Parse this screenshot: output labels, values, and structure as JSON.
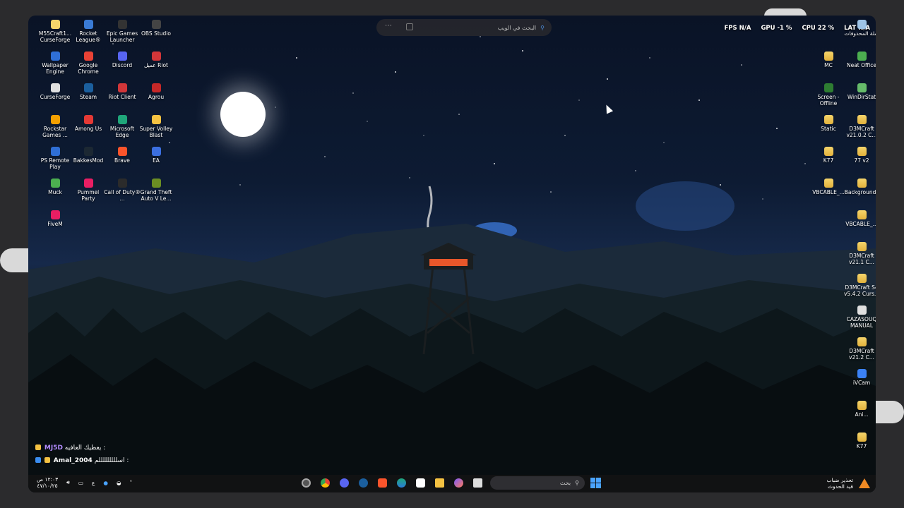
{
  "web_search": {
    "placeholder": "البحث في الويب"
  },
  "stats": {
    "fps_label": "FPS",
    "fps": "N/A",
    "gpu_label": "GPU",
    "gpu": "-1 %",
    "cpu_label": "CPU",
    "cpu": "22 %",
    "lat_label": "LAT",
    "lat": "N/A"
  },
  "desktop_left": [
    {
      "label": "M55Craft1... CurseForge",
      "icon": "curseforge-folder-icon",
      "color": "#f5d46b"
    },
    {
      "label": "Rocket League®",
      "icon": "rocket-league-icon",
      "color": "#3a7bd5"
    },
    {
      "label": "Epic Games Launcher",
      "icon": "epic-games-icon",
      "color": "#333333"
    },
    {
      "label": "OBS Studio",
      "icon": "obs-icon",
      "color": "#444444"
    },
    {
      "label": "Wallpaper Engine",
      "icon": "wallpaper-engine-icon",
      "color": "#2f6fd6"
    },
    {
      "label": "Google Chrome",
      "icon": "chrome-icon",
      "color": "#e94235"
    },
    {
      "label": "Discord",
      "icon": "discord-icon",
      "color": "#5865f2"
    },
    {
      "label": "عميل Riot",
      "icon": "riot-icon",
      "color": "#d13639"
    },
    {
      "label": "CurseForge",
      "icon": "curseforge-icon",
      "color": "#e0e0e0"
    },
    {
      "label": "Steam",
      "icon": "steam-icon",
      "color": "#1b5f9e"
    },
    {
      "label": "Riot Client",
      "icon": "riot-client-icon",
      "color": "#d13639"
    },
    {
      "label": "Agrou",
      "icon": "agrou-icon",
      "color": "#c62828"
    },
    {
      "label": "Rockstar Games ...",
      "icon": "rockstar-icon",
      "color": "#f4a000"
    },
    {
      "label": "Among Us",
      "icon": "among-us-icon",
      "color": "#e53935"
    },
    {
      "label": "Microsoft Edge",
      "icon": "edge-icon",
      "color": "#1fa67a"
    },
    {
      "label": "Super Volley Blast",
      "icon": "volley-icon",
      "color": "#f5c242"
    },
    {
      "label": "PS Remote Play",
      "icon": "ps-remote-icon",
      "color": "#2f6fd6"
    },
    {
      "label": "BakkesMod",
      "icon": "bakkesmod-icon",
      "color": "#1c2833"
    },
    {
      "label": "Brave",
      "icon": "brave-icon",
      "color": "#fb542b"
    },
    {
      "label": "EA",
      "icon": "ea-icon",
      "color": "#3b6fe0"
    },
    {
      "label": "Muck",
      "icon": "muck-icon",
      "color": "#4caf50"
    },
    {
      "label": "Pummel Party",
      "icon": "pummel-party-icon",
      "color": "#e91e63"
    },
    {
      "label": "Call of Duty® ...",
      "icon": "cod-icon",
      "color": "#2b2b2b"
    },
    {
      "label": "Grand Theft Auto V Le...",
      "icon": "gta-icon",
      "color": "#6b8e23"
    },
    {
      "label": "FiveM",
      "icon": "fivem-icon",
      "color": "#e91e63"
    }
  ],
  "desktop_right": [
    {
      "label": "سلة المحذوفات",
      "icon": "recycle-bin-icon",
      "color": "#9ec3e6"
    },
    {
      "label": "MC",
      "icon": "folder-icon",
      "color": "#f5d46b"
    },
    {
      "label": "Neat Office",
      "icon": "neat-office-icon",
      "color": "#4caf50"
    },
    {
      "label": "Screen - Offline",
      "icon": "screen-icon",
      "color": "#2e7d32"
    },
    {
      "label": "WinDirStat",
      "icon": "windirstat-icon",
      "color": "#66bb6a"
    },
    {
      "label": "Static",
      "icon": "folder-icon",
      "color": "#f5d46b"
    },
    {
      "label": "D3MCraft v21.0.2 C...",
      "icon": "folder-icon",
      "color": "#f5d46b"
    },
    {
      "label": "K77",
      "icon": "folder-icon",
      "color": "#f5d46b"
    },
    {
      "label": "77 v2",
      "icon": "folder-icon",
      "color": "#f5d46b"
    },
    {
      "label": "VBCABLE_...",
      "icon": "folder-icon",
      "color": "#f5d46b"
    },
    {
      "label": "Backgrounds",
      "icon": "folder-icon",
      "color": "#f5d46b"
    },
    {
      "label": "VBCABLE_...",
      "icon": "folder-icon",
      "color": "#f5d46b"
    },
    {
      "label": "D3MCraft v21.1 C...",
      "icon": "folder-icon",
      "color": "#f5d46b"
    },
    {
      "label": "D3MCraft S4 v5.4.2 Curs...",
      "icon": "folder-icon",
      "color": "#f5d46b"
    },
    {
      "label": "CAZASOUQ MANUAL",
      "icon": "document-icon",
      "color": "#e0e0e0"
    },
    {
      "label": "D3MCraft v21.2 C...",
      "icon": "folder-icon",
      "color": "#f5d46b"
    },
    {
      "label": "iVCam",
      "icon": "ivcam-icon",
      "color": "#3b82f6"
    },
    {
      "label": "Ani...",
      "icon": "folder-icon",
      "color": "#f5d46b"
    },
    {
      "label": "K77",
      "icon": "folder-icon",
      "color": "#f5d46b"
    }
  ],
  "chat": [
    {
      "user": "MJ5D",
      "message": "يعطيك العافيه :"
    },
    {
      "user": "Amal_2004",
      "message": "اسلللللللللم :"
    }
  ],
  "taskbar": {
    "clock_time": "١٢:٠٣ ص",
    "clock_date": "٤٧/١٠/٢٥",
    "lang": "ع",
    "search_placeholder": "بحث",
    "weather_line1": "تحذير ضباب",
    "weather_line2": "قيد الحدوث"
  }
}
